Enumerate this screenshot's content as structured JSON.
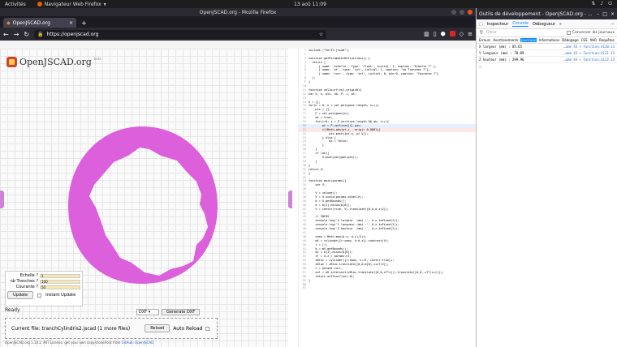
{
  "topbar": {
    "activities": "Activités",
    "app": "Navigateur Web Firefox",
    "clock": "13 aoû  11:09"
  },
  "browser": {
    "title": "OpenJSCAD.org - Mozilla Firefox",
    "tab": "OpenJSCAD.org",
    "url": "https://openjscad.org"
  },
  "app": {
    "logo": "OpenJSCAD.org",
    "logo_version": "beta",
    "params": [
      {
        "label": "Echelle ?",
        "value": "1"
      },
      {
        "label": "nb Tranches ?",
        "value": "100"
      },
      {
        "label": "Courante ?",
        "value": "50"
      }
    ],
    "update_label": "Update",
    "instant_update_label": "Instant Update",
    "status": "Ready",
    "format": "DXF",
    "generate_label": "Generate DXF",
    "current_file": "Current file: tranchCylindris2.jscad (1 more files)",
    "reload_label": "Reload",
    "auto_reload_label": "Auto Reload",
    "footer": "OpenJSCAD.org 1.10.2, MIT License, get your own copy/clone/fork from",
    "footer_link": "GitHub: OpenJSCAD",
    "shape_color": "#dc5fdc"
  },
  "editor": {
    "lines": [
      {
        "n": "1",
        "t": "include (\"herJS.jscad\");"
      },
      {
        "n": "2",
        "t": ""
      },
      {
        "n": "3",
        "t": "function getParameterDefinitions() {"
      },
      {
        "n": "4",
        "t": "  return ["
      },
      {
        "n": "5",
        "t": "      { name: 'echelle', type: 'float', initial: 1, caption: \"Echelle ?\" },"
      },
      {
        "n": "6",
        "t": "      { name: 'nt', type: 'int', initial: 1, caption: \"nb Tranches ?\"},"
      },
      {
        "n": "7",
        "t": "      { name: 'curr', type: 'int', initial: 0, min:0, caption: \"Courante ?\"}"
      },
      {
        "n": "8",
        "t": "  ];"
      },
      {
        "n": "9",
        "t": "}"
      },
      {
        "n": "10",
        "t": ""
      },
      {
        "n": "11",
        "t": "function vol2surf(vol,origin0){"
      },
      {
        "n": "12",
        "t": "var S, n, pts, ok, P, i, pt;"
      },
      {
        "n": "13",
        "t": ""
      },
      {
        "n": "14",
        "t": "S = [];"
      },
      {
        "n": "15",
        "t": "for(n = 0; n < vol.polygons.length; n++){"
      },
      {
        "n": "16",
        "t": "    pts = [];"
      },
      {
        "n": "17",
        "t": "    P = vol.polygons[n];"
      },
      {
        "n": "18",
        "t": "    ok = true;"
      },
      {
        "n": "19",
        "t": "    for(i=0; i < P.vertices.length && ok; i++){"
      },
      {
        "n": "20",
        "t": "        pt = P.vertices[i].pos;"
      },
      {
        "n": "21",
        "t": "        if(Math.abs(pt.z - orig)< 0.0001){"
      },
      {
        "n": "22",
        "t": "            pts.push([pt.x, pt.y]);"
      },
      {
        "n": "23",
        "t": "        } else {"
      },
      {
        "n": "24",
        "t": "            ok = false;"
      },
      {
        "n": "25",
        "t": "        }"
      },
      {
        "n": "26",
        "t": "    }"
      },
      {
        "n": "27",
        "t": "    if (ok){"
      },
      {
        "n": "28",
        "t": "        S.push(polygon(pts));"
      },
      {
        "n": "29",
        "t": "    }"
      },
      {
        "n": "30",
        "t": "}"
      },
      {
        "n": "31",
        "t": "return S;"
      },
      {
        "n": "32",
        "t": "}"
      },
      {
        "n": "33",
        "t": ""
      },
      {
        "n": "34",
        "t": "function main(params){"
      },
      {
        "n": "35",
        "t": "    var V;"
      },
      {
        "n": "36",
        "t": ""
      },
      {
        "n": "37",
        "t": "    V = volume();"
      },
      {
        "n": "38",
        "t": "    V = V.scale(params.echelle);"
      },
      {
        "n": "39",
        "t": "    b = V.getBounds();"
      },
      {
        "n": "40",
        "t": "    d = b[1].minus(b[0]);"
      },
      {
        "n": "41",
        "t": "    V = center(true, V).translate([0,0,d.z/2]);"
      },
      {
        "n": "42",
        "t": ""
      },
      {
        "n": "43",
        "t": "    // INFOS"
      },
      {
        "n": "44",
        "t": "    console.log('X largeur  (mm) :', d.x.toFixed(2));"
      },
      {
        "n": "45",
        "t": "    console.log('Y longueur (mm) :', d.y.toFixed(2));"
      },
      {
        "n": "46",
        "t": "    console.log('Z hauteur  (mm) :', d.z.toFixed(2));"
      },
      {
        "n": "47",
        "t": ""
      },
      {
        "n": "48",
        "t": "    cmax = Math.max(d.x, d.y)/2+1;"
      },
      {
        "n": "49",
        "t": "    mV = cylinder({r:cmax, h:d.z}).subtract(V);"
      },
      {
        "n": "50",
        "t": "    r = [];"
      },
      {
        "n": "51",
        "t": "    b = mV.getBounds();"
      },
      {
        "n": "52",
        "t": "    d2 = b[1].minus(b[0]);"
      },
      {
        "n": "53",
        "t": "    zT = d.z / params.nT;"
      },
      {
        "n": "54",
        "t": "    zBloc = cylinder({r:cmax, h:zT, center:true});"
      },
      {
        "n": "55",
        "t": "    zBloc = zBloc.translate([0,0,b[0].z+zT/2]);"
      },
      {
        "n": "56",
        "t": "    i = params.curr;"
      },
      {
        "n": "57",
        "t": "    vol = mV.intersect(zBloc.translate([0,0,zT*i])).translate([0,0,-zT*(i+1)]);"
      },
      {
        "n": "58",
        "t": "    return vol2surf(vol,0);"
      },
      {
        "n": "59",
        "t": "}"
      },
      {
        "n": "60",
        "t": ""
      },
      {
        "n": "61",
        "t": ""
      }
    ]
  },
  "devtools": {
    "title": "Outils de développement - OpenJSCAD.org - ...",
    "tabs": [
      "Inspecteur",
      "Console",
      "Débogueur"
    ],
    "filter_placeholder": "Filtrer",
    "persist_label": "Conserver les journaux",
    "categories": [
      "Erreurs",
      "Avertissements",
      "Journaux",
      "Informations",
      "Débogage",
      "CSS",
      "XHR",
      "Requêtes"
    ],
    "logs": [
      {
        "text": "X largeur  (mm) : 85.65",
        "source": "…ame 43 > Function:4120:13"
      },
      {
        "text": "Y longueur (mm) : 78.89",
        "source": "…ame 43 > Function:4121:13"
      },
      {
        "text": "Z hauteur  (mm) : 299.96",
        "source": "…ame 43 > Function:4122:13"
      }
    ],
    "prompt": "»"
  }
}
